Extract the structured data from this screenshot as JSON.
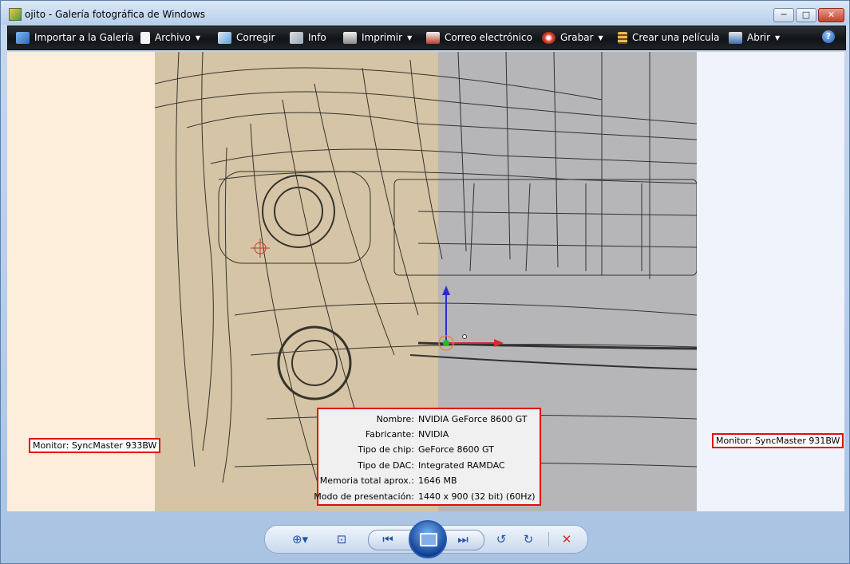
{
  "window": {
    "title": "ojito - Galería fotográfica de Windows",
    "controls": {
      "minimize": "─",
      "maximize": "□",
      "close": "✕"
    }
  },
  "toolbar": {
    "items": [
      {
        "label": "Importar a la Galería",
        "icon": "import-icon",
        "has_menu": false
      },
      {
        "label": "Archivo",
        "icon": "file-icon",
        "has_menu": true
      },
      {
        "label": "Corregir",
        "icon": "fix-icon",
        "has_menu": false
      },
      {
        "label": "Info",
        "icon": "info-icon",
        "has_menu": false
      },
      {
        "label": "Imprimir",
        "icon": "printer-icon",
        "has_menu": true
      },
      {
        "label": "Correo electrónico",
        "icon": "email-icon",
        "has_menu": false
      },
      {
        "label": "Grabar",
        "icon": "burn-disc-icon",
        "has_menu": true
      },
      {
        "label": "Crear una película",
        "icon": "film-icon",
        "has_menu": false
      },
      {
        "label": "Abrir",
        "icon": "open-icon",
        "has_menu": true
      }
    ],
    "arrow": "▼",
    "help": "?"
  },
  "monitors": {
    "left": "Monitor:  SyncMaster 933BW",
    "right": "Monitor:  SyncMaster 931BW"
  },
  "gpu_info": {
    "rows": [
      {
        "key": "Nombre:",
        "value": "NVIDIA GeForce 8600 GT"
      },
      {
        "key": "Fabricante:",
        "value": "NVIDIA"
      },
      {
        "key": "Tipo de chip:",
        "value": "GeForce 8600 GT"
      },
      {
        "key": "Tipo de DAC:",
        "value": "Integrated RAMDAC"
      },
      {
        "key": "Memoria total aprox.:",
        "value": "1646 MB"
      },
      {
        "key": "Modo de presentación:",
        "value": "1440 x 900 (32 bit) (60Hz)"
      }
    ]
  },
  "navigation": {
    "zoom": "⊕▾",
    "fit": "⊡",
    "previous": "⏮",
    "next": "⏭",
    "rotate_left": "↺",
    "rotate_right": "↻",
    "delete": "✕"
  },
  "colors": {
    "highlight_border": "#e20d0d",
    "toolbar_bg": "#16191d",
    "left_monitor_bg": "#fdeedb",
    "right_monitor_bg": "#f0f2fc"
  }
}
